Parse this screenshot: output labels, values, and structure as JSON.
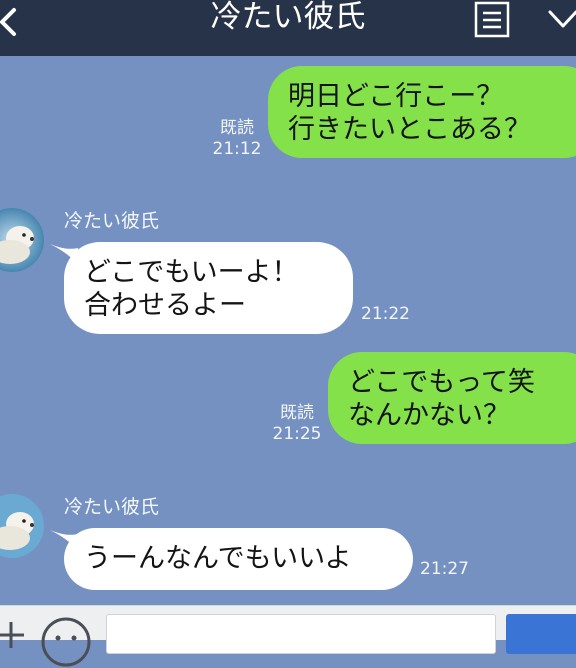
{
  "header": {
    "title": "冷たい彼氏"
  },
  "messages": [
    {
      "from": "me",
      "text": "明日どこ行こー？\n行きたいとこある？",
      "read": "既読",
      "time": "21:12"
    },
    {
      "from": "them",
      "name": "冷たい彼氏",
      "text": "どこでもいーよ！\n合わせるよー",
      "time": "21:22"
    },
    {
      "from": "me",
      "text": "どこでもって笑\nなんかない？",
      "read": "既読",
      "time": "21:25"
    },
    {
      "from": "them",
      "name": "冷たい彼氏",
      "text": "うーんなんでもいいよ",
      "time": "21:27"
    }
  ],
  "colors": {
    "chat_background": "#7591c1",
    "header": "#273348",
    "my_bubble": "#84e14a",
    "their_bubble": "#ffffff",
    "send_button": "#3a75d6"
  },
  "icons": [
    "back-icon",
    "menu-icon",
    "chevron-down-icon",
    "plus-icon",
    "emoji-icon",
    "avatar-polar-bear"
  ]
}
